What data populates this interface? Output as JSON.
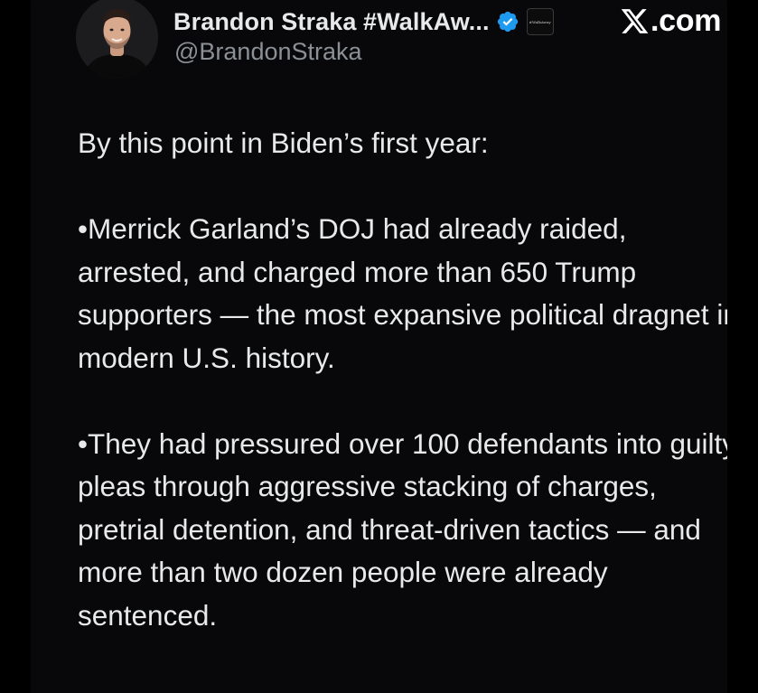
{
  "author": {
    "display_name": "Brandon Straka #WalkAw...",
    "handle": "@BrandonStraka",
    "verified_icon": "verified-badge-icon",
    "affiliate_badge_text": "#WalkAway"
  },
  "source": {
    "logo_icon": "x-logo-icon",
    "label": ".com"
  },
  "tweet": {
    "paragraphs": [
      "By this point in Biden’s first year:",
      "•Merrick Garland’s DOJ had already raided, arrested, and charged more than 650 Trump supporters — the most expansive political dragnet in modern U.S. history.",
      "•They had pressured over 100 defendants into guilty pleas through aggressive stacking of charges, pretrial detention, and threat-driven tactics — and more than two dozen people were already sentenced."
    ]
  },
  "colors": {
    "background": "#000000",
    "card": "#08080a",
    "text_primary": "#e7e9ea",
    "text_secondary": "#8b9096",
    "verified_blue": "#1d9bf0"
  }
}
